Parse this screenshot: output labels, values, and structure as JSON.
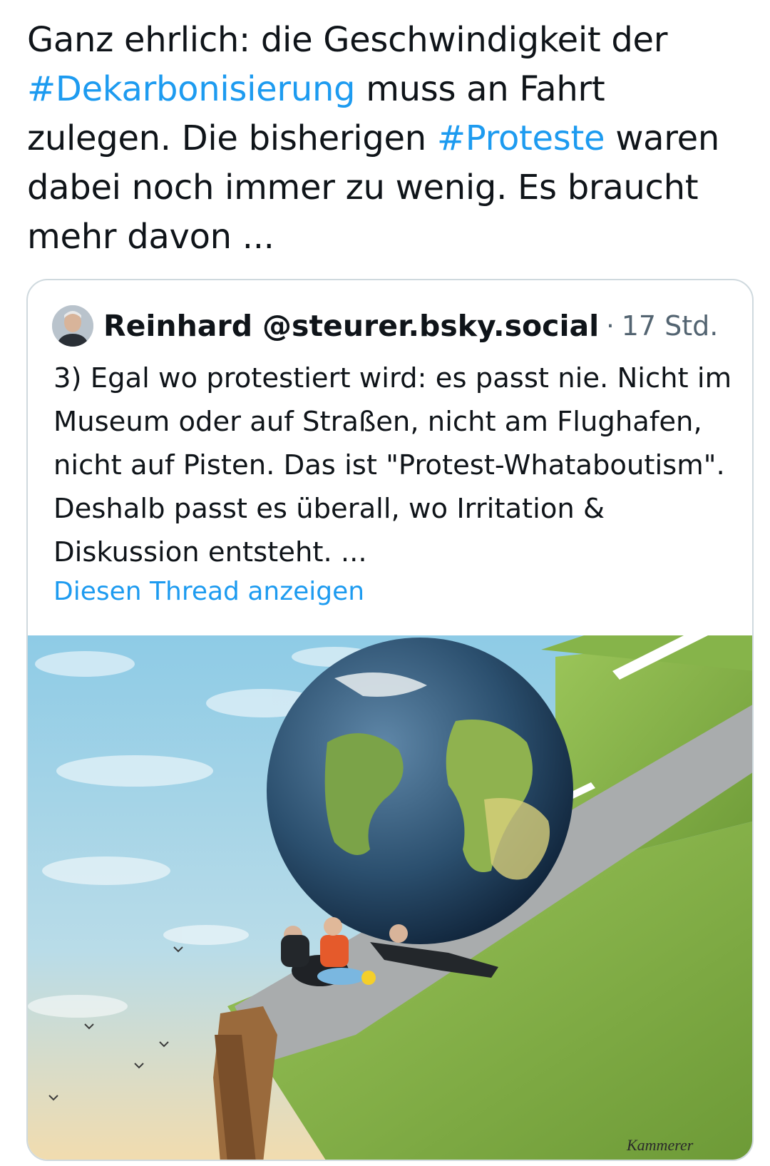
{
  "tweet": {
    "text_1": "Ganz ehrlich: die Geschwindigkeit der",
    "hashtag_1": "#Dekarbonisierung",
    "text_2": "muss an Fahrt zulegen. Die bisherigen",
    "hashtag_2": "#Proteste",
    "text_3": "waren dabei noch immer zu wenig. Es braucht mehr davon ..."
  },
  "quote": {
    "author_name": "Reinhard",
    "author_handle": "@steurer.bsky.social",
    "separator": "·",
    "time": "17 Std.",
    "text": "3) Egal wo protestiert wird: es passt nie. Nicht im Museum oder auf Straßen, nicht am Flughafen, nicht auf Pisten. Das ist \"Protest-Whataboutism\". Deshalb passt es überall, wo Irritation & Diskussion entsteht. ...",
    "thread_link": "Diesen Thread anzeigen"
  },
  "image": {
    "signature": "Kammerer",
    "colors": {
      "sky_top": "#8ecbe6",
      "sky_bottom": "#f2dcae",
      "grass": "#7fae43",
      "road": "#a9acad",
      "globe_ocean": "#2b4f6e",
      "land": "#7ba348",
      "cliff": "#9a6a3c"
    }
  },
  "colors": {
    "link": "#1d9bf0",
    "text": "#0f1419",
    "muted": "#536471",
    "border": "#cfd9de"
  }
}
